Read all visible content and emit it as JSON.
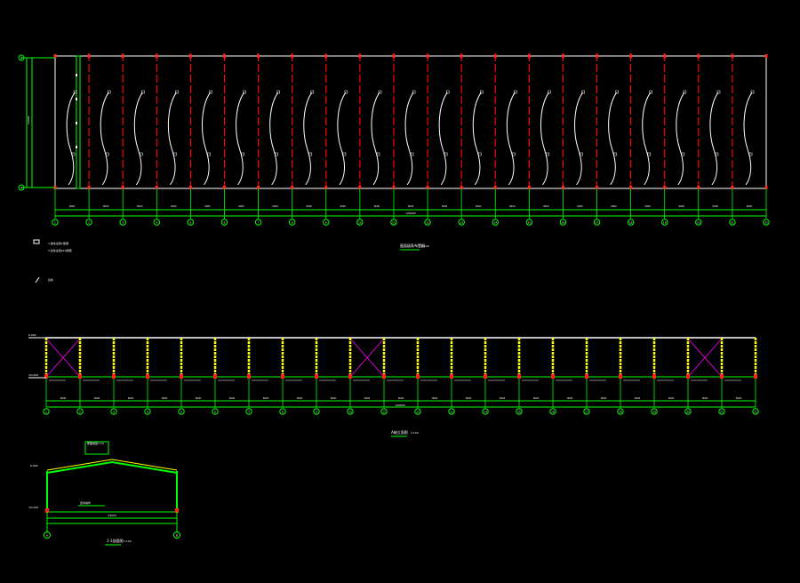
{
  "colors": {
    "background": "#000000",
    "outline": "#ffffff",
    "dim": "#00ff00",
    "column": "#ff2222",
    "axis_dash": "#ff0000",
    "bracing": "#ff00ff",
    "member": "#ffff00",
    "note": "#ffffff"
  },
  "plan": {
    "grid_labels": [
      "1",
      "2",
      "3",
      "4",
      "5",
      "6",
      "7",
      "8",
      "9",
      "10",
      "11",
      "12",
      "13",
      "14",
      "15",
      "16",
      "17",
      "18",
      "19",
      "20",
      "21",
      "22"
    ],
    "row_labels": [
      "B",
      "A"
    ],
    "bay_dim_label": "6000",
    "total_dim_label": "126000",
    "height_dim_label": "24000",
    "title": "屋面檩条布置图",
    "scale": "1:100"
  },
  "notes": {
    "line1": "1.檩条采用C型钢",
    "line2": "2.拉条采用φ12圆钢",
    "symbol_text": "拉条"
  },
  "elevation": {
    "grid_labels": [
      "1",
      "2",
      "3",
      "4",
      "5",
      "6",
      "7",
      "8",
      "9",
      "10",
      "11",
      "12",
      "13",
      "14",
      "15",
      "16",
      "17",
      "18",
      "19",
      "20",
      "21",
      "22"
    ],
    "top_level": "6.000",
    "base_level": "±0.000",
    "bay_dim_label": "6000",
    "total_dim_label": "126000",
    "title": "A轴立面图",
    "scale": "1:100"
  },
  "section": {
    "grid_labels": [
      "A",
      "B"
    ],
    "top_level": "6.000",
    "base_level": "±0.000",
    "ridge_note": "屋面坡度1:10",
    "floor_note": "室内地坪",
    "span_label": "24000",
    "title": "1-1剖面图",
    "scale": "1:100"
  }
}
